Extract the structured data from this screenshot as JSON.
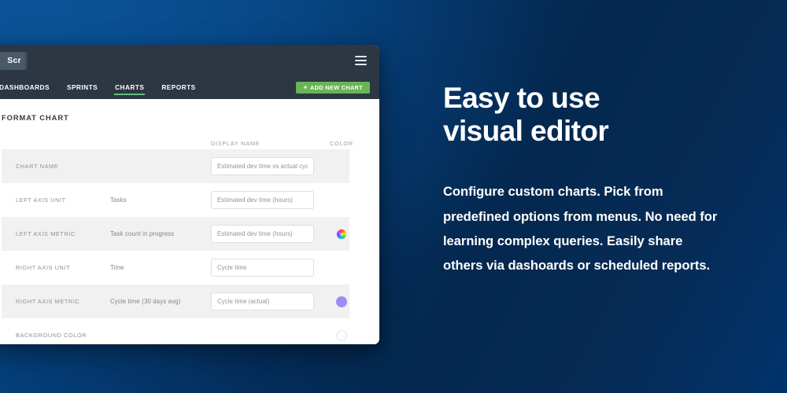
{
  "app_window": {
    "brand_logo_text": "Scr",
    "menu_icon": "hamburger-menu-icon",
    "nav_tabs": [
      {
        "label": "DASHBOARDS",
        "active": false
      },
      {
        "label": "SPRINTS",
        "active": false
      },
      {
        "label": "CHARTS",
        "active": true
      },
      {
        "label": "REPORTS",
        "active": false
      }
    ],
    "add_new_chart_button": {
      "plus": "+",
      "label": "ADD NEW CHART",
      "color": "#6ab455"
    },
    "panel": {
      "title": "FORMAT CHART",
      "columns": {
        "label": "",
        "value": "",
        "display_name": "DISPLAY NAME",
        "color": "COLOR"
      },
      "rows": [
        {
          "label": "CHART NAME",
          "value": "",
          "display_name": "Estimated dev time vs actual cycle time",
          "color_swatch": "none",
          "color_hex": "",
          "striped": true
        },
        {
          "label": "LEFT AXIS UNIT",
          "value": "Tasks",
          "display_name": "Estimated dev time (hours)",
          "color_swatch": "none",
          "color_hex": "",
          "striped": false
        },
        {
          "label": "LEFT AXIS METRIC",
          "value": "Task count in progress",
          "display_name": "Estimated dev time (hours)",
          "color_swatch": "rainbow",
          "color_hex": "rainbow",
          "striped": true
        },
        {
          "label": "RIGHT AXIS UNIT",
          "value": "Time",
          "display_name": "Cycle time",
          "color_swatch": "none",
          "color_hex": "",
          "striped": false
        },
        {
          "label": "RIGHT AXIS METRIC",
          "value": "Cycle time (30 days avg)",
          "display_name": "Cycle time (actual)",
          "color_swatch": "solid",
          "color_hex": "#9b8cf2",
          "striped": true
        },
        {
          "label": "BACKGROUND COLOR",
          "value": "",
          "display_name": "",
          "color_swatch": "empty",
          "color_hex": "#fbfcfd",
          "striped": false
        }
      ]
    }
  },
  "marketing": {
    "heading": "Easy to use\nvisual editor",
    "body": "Configure custom charts. Pick from predefined options from menus. No need for learning complex queries. Easily share others via dashoards or scheduled reports."
  },
  "theme": {
    "background_gradient_start": "#0a4f93",
    "background_gradient_end": "#00336b",
    "topbar": "#2c3743",
    "accent_green": "#6ab455",
    "striped_row": "#f1f1f1"
  }
}
